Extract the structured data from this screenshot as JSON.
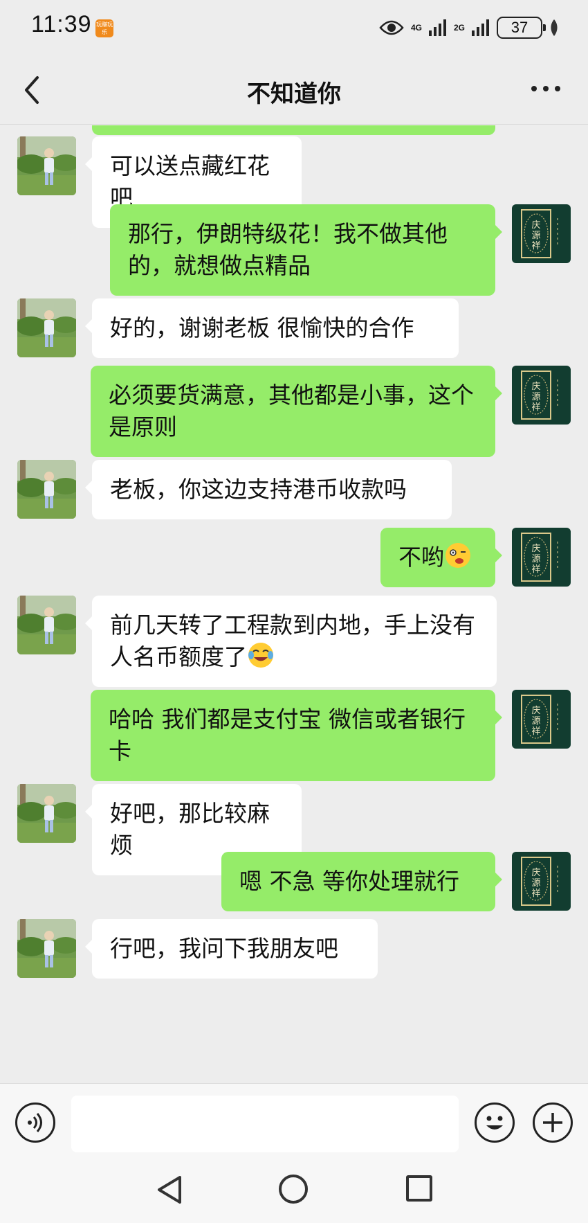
{
  "status_bar": {
    "time": "11:39",
    "app_badge": "玩赚玩乐",
    "network_1": "4G",
    "network_2": "2G",
    "battery": "37"
  },
  "header": {
    "title": "不知道你"
  },
  "messages": [
    {
      "side": "left",
      "text": "可以送点藏红花吧"
    },
    {
      "side": "right",
      "text": "那行，伊朗特级花！我不做其他的，就想做点精品"
    },
    {
      "side": "left",
      "text": "好的，谢谢老板 很愉快的合作"
    },
    {
      "side": "right",
      "text": "必须要货满意，其他都是小事，这个是原则"
    },
    {
      "side": "left",
      "text": "老板，你这边支持港币收款吗"
    },
    {
      "side": "right",
      "text": "不哟",
      "emoji": "dizzy-face-emoji"
    },
    {
      "side": "left",
      "text": "前几天转了工程款到内地，手上没有人名币额度了",
      "emoji": "crying-laughing-emoji"
    },
    {
      "side": "right",
      "text": "哈哈 我们都是支付宝 微信或者银行卡"
    },
    {
      "side": "left",
      "text": "好吧，那比较麻烦"
    },
    {
      "side": "right",
      "text": "嗯 不急 等你处理就行"
    },
    {
      "side": "left",
      "text": "行吧，我问下我朋友吧"
    }
  ],
  "input_bar": {
    "message_value": "",
    "voice_icon": "voice-icon",
    "emoji_icon": "smiley-icon",
    "plus_icon": "plus-icon"
  },
  "colors": {
    "background": "#ededed",
    "sent_bubble": "#95ec69",
    "received_bubble": "#ffffff"
  }
}
